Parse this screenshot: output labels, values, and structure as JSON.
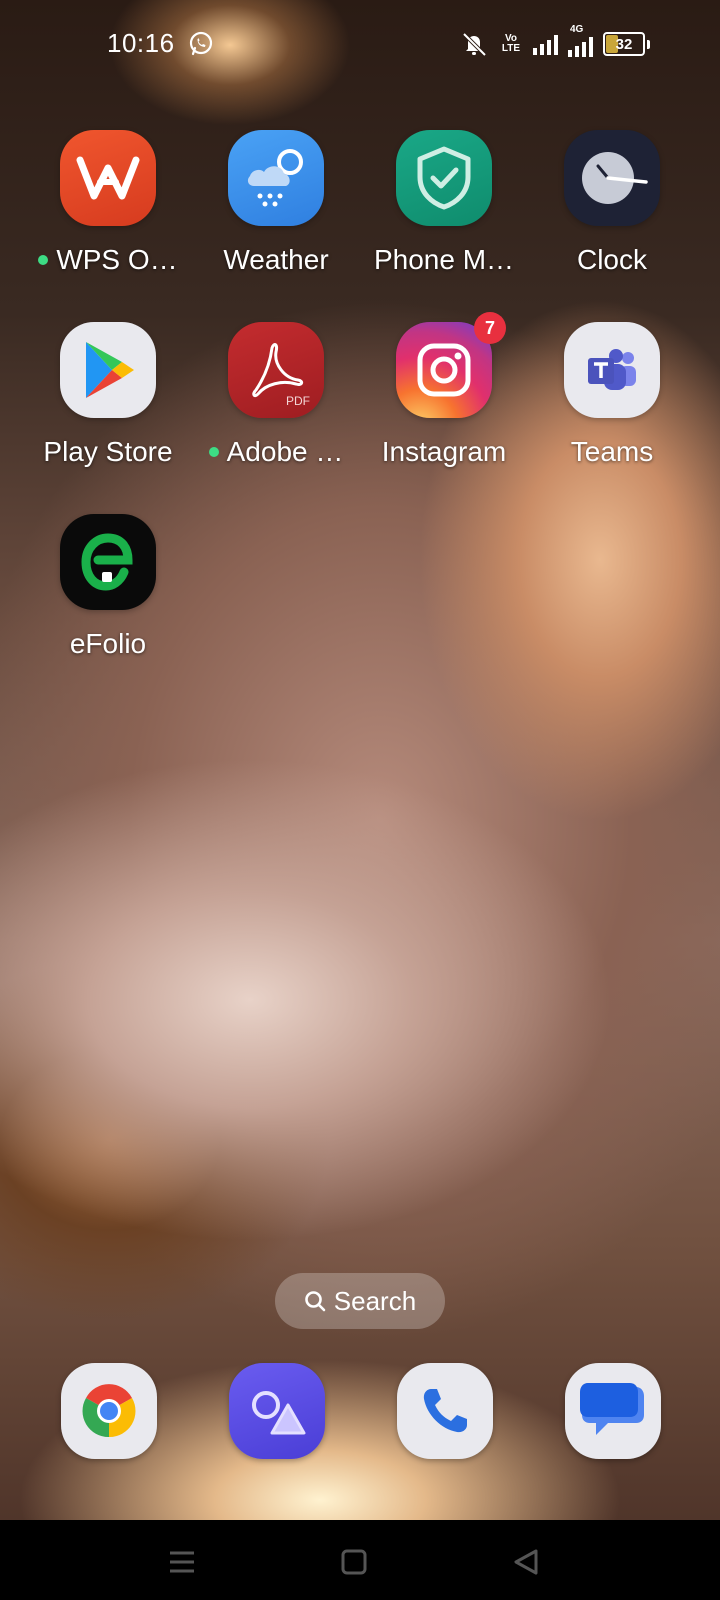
{
  "status_bar": {
    "time": "10:16",
    "network_volte": "Vo LTE",
    "network_type": "4G",
    "battery": "32",
    "battery_level_percent": 32,
    "icons": [
      "whatsapp-icon",
      "mute-icon",
      "volte-icon",
      "signal-icon",
      "signal-4g-icon",
      "battery-icon"
    ]
  },
  "apps": [
    {
      "label": "WPS O…",
      "icon": "wps-office-icon",
      "dot": true
    },
    {
      "label": "Weather",
      "icon": "weather-icon",
      "dot": false
    },
    {
      "label": "Phone M…",
      "icon": "phone-manager-icon",
      "dot": false
    },
    {
      "label": "Clock",
      "icon": "clock-icon",
      "dot": false
    },
    {
      "label": "Play Store",
      "icon": "play-store-icon",
      "dot": false
    },
    {
      "label": "Adobe …",
      "icon": "adobe-acrobat-icon",
      "dot": true,
      "sublabel": "PDF"
    },
    {
      "label": "Instagram",
      "icon": "instagram-icon",
      "dot": false,
      "badge": "7"
    },
    {
      "label": "Teams",
      "icon": "teams-icon",
      "dot": false
    },
    {
      "label": "eFolio",
      "icon": "efolio-icon",
      "dot": false
    }
  ],
  "search": {
    "label": "Search"
  },
  "dock": [
    {
      "name": "chrome",
      "icon": "chrome-icon"
    },
    {
      "name": "gallery",
      "icon": "gallery-icon"
    },
    {
      "name": "phone",
      "icon": "phone-icon"
    },
    {
      "name": "messages",
      "icon": "messages-icon"
    }
  ],
  "navigation": [
    "menu-nav-icon",
    "home-nav-icon",
    "back-nav-icon"
  ],
  "colors": {
    "notification_dot": "#3ddc84",
    "badge": "#e8303f",
    "wps": "#e8452c",
    "weather": "#3a8fe8",
    "phone_manager": "#16997a",
    "clock": "#1e2235",
    "adobe": "#b32428",
    "teams": "#5059c9",
    "gallery": "#5a4de0"
  }
}
